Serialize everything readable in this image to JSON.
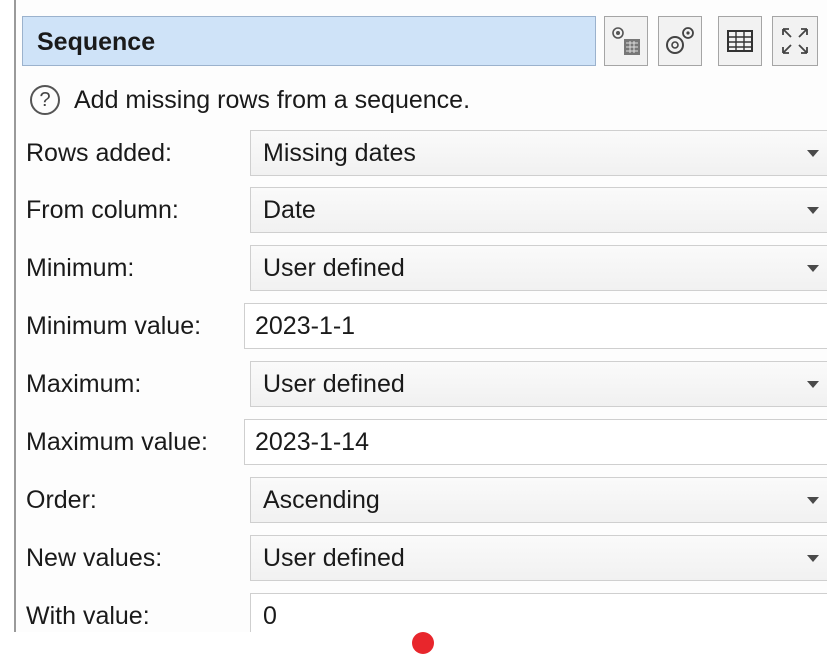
{
  "header": {
    "title": "Sequence",
    "toolbar": [
      {
        "name": "calculator-settings-icon"
      },
      {
        "name": "gears-icon"
      },
      {
        "name": "table-icon"
      },
      {
        "name": "expand-icon"
      }
    ]
  },
  "help": {
    "icon": "question-circle-icon",
    "text": "Add missing rows from a sequence."
  },
  "fields": {
    "rows_added": {
      "label": "Rows added:",
      "value": "Missing dates"
    },
    "from_column": {
      "label": "From column:",
      "value": "Date"
    },
    "minimum": {
      "label": "Minimum:",
      "value": "User defined"
    },
    "minimum_value": {
      "label": "Minimum value:",
      "value": "2023-1-1"
    },
    "maximum": {
      "label": "Maximum:",
      "value": "User defined"
    },
    "maximum_value": {
      "label": "Maximum value:",
      "value": "2023-1-14"
    },
    "order": {
      "label": "Order:",
      "value": "Ascending"
    },
    "new_values": {
      "label": "New values:",
      "value": "User defined"
    },
    "with_value": {
      "label": "With value:",
      "value": "0"
    }
  },
  "colors": {
    "title_bg": "#cfe3f8",
    "cursor_marker": "#e8262c"
  }
}
